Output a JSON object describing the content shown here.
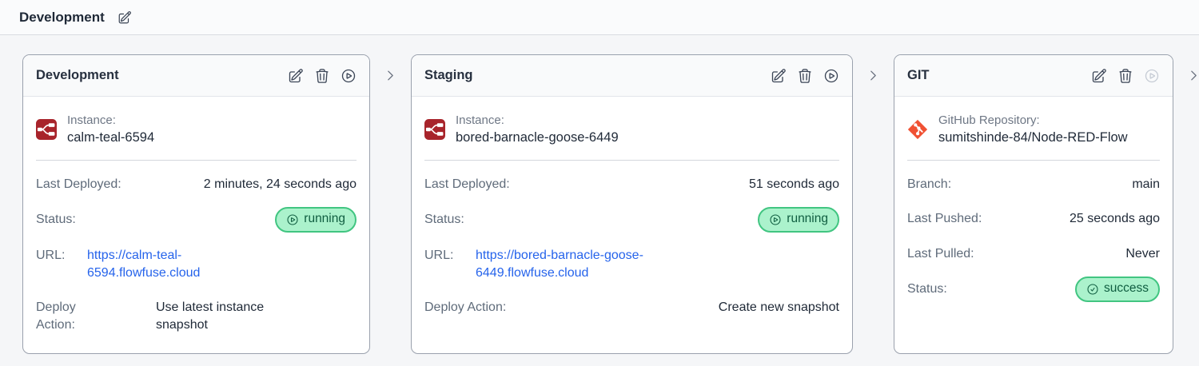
{
  "page": {
    "title": "Development"
  },
  "colors": {
    "status_green_bg": "#abf2cc",
    "status_green_border": "#41c581",
    "status_green_text": "#0f5d40",
    "link_blue": "#2563eb",
    "node_red_brand": "#a8242b",
    "git_orange": "#f05133"
  },
  "stages": [
    {
      "header": {
        "title": "Development"
      },
      "source": {
        "icon": "node-red-icon",
        "label": "Instance:",
        "value": "calm-teal-6594"
      },
      "rows": {
        "deployed": {
          "label": "Last Deployed:",
          "value": "2 minutes, 24 seconds ago"
        },
        "status": {
          "label": "Status:",
          "value": "running"
        },
        "url": {
          "label": "URL:",
          "value": "https://calm-teal-6594.flowfuse.cloud"
        },
        "action": {
          "label": "Deploy Action:",
          "value": "Use latest instance snapshot"
        }
      }
    },
    {
      "header": {
        "title": "Staging"
      },
      "source": {
        "icon": "node-red-icon",
        "label": "Instance:",
        "value": "bored-barnacle-goose-6449"
      },
      "rows": {
        "deployed": {
          "label": "Last Deployed:",
          "value": "51 seconds ago"
        },
        "status": {
          "label": "Status:",
          "value": "running"
        },
        "url": {
          "label": "URL:",
          "value": "https://bored-barnacle-goose-6449.flowfuse.cloud"
        },
        "action": {
          "label": "Deploy Action:",
          "value": "Create new snapshot"
        }
      }
    },
    {
      "header": {
        "title": "GIT"
      },
      "source": {
        "icon": "git-icon",
        "label": "GitHub Repository:",
        "value": "sumitshinde-84/Node-RED-Flow"
      },
      "rows": {
        "branch": {
          "label": "Branch:",
          "value": "main"
        },
        "pushed": {
          "label": "Last Pushed:",
          "value": "25 seconds ago"
        },
        "pulled": {
          "label": "Last Pulled:",
          "value": "Never"
        },
        "status": {
          "label": "Status:",
          "value": "success"
        }
      }
    }
  ]
}
